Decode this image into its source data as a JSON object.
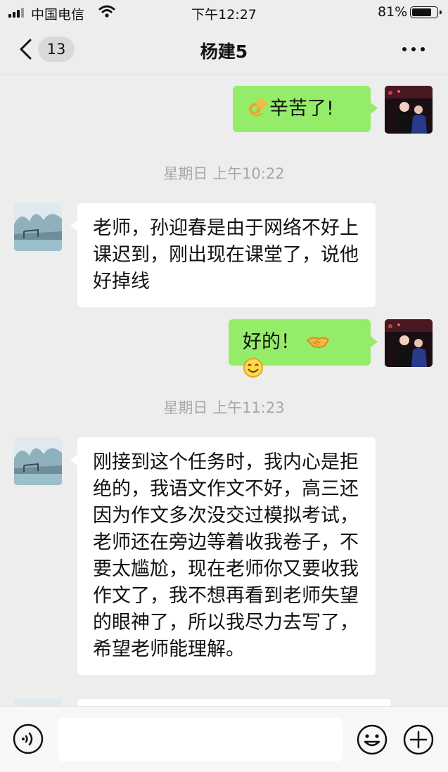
{
  "status_bar": {
    "carrier": "中国电信",
    "time": "下午12:27",
    "battery_percent": "81%",
    "battery_level": 0.81
  },
  "header": {
    "back_count": "13",
    "title": "杨建5"
  },
  "messages": [
    {
      "from": "me",
      "text": "辛苦了!",
      "emoji": "ok-hand"
    },
    {
      "type": "timestamp",
      "text": "星期日 上午10:22"
    },
    {
      "from": "contact",
      "text": "老师，孙迎春是由于网络不好上课迟到，刚出现在课堂了，说他好掉线"
    },
    {
      "from": "me",
      "text": "好的！",
      "emoji": "handshake, smile"
    },
    {
      "type": "timestamp",
      "text": "星期日 上午11:23"
    },
    {
      "from": "contact",
      "text": "刚接到这个任务时，我内心是拒绝的，我语文作文不好，高三还因为作文多次没交过模拟考试，老师还在旁边等着收我卷子，不要太尴尬，现在老师你又要收我作文了，我不想再看到老师失望的眼神了，所以我尽力去写了，希望老师能理解。"
    }
  ],
  "colors": {
    "my_bubble": "#95ec69",
    "their_bubble": "#ffffff",
    "background": "#ededed"
  }
}
